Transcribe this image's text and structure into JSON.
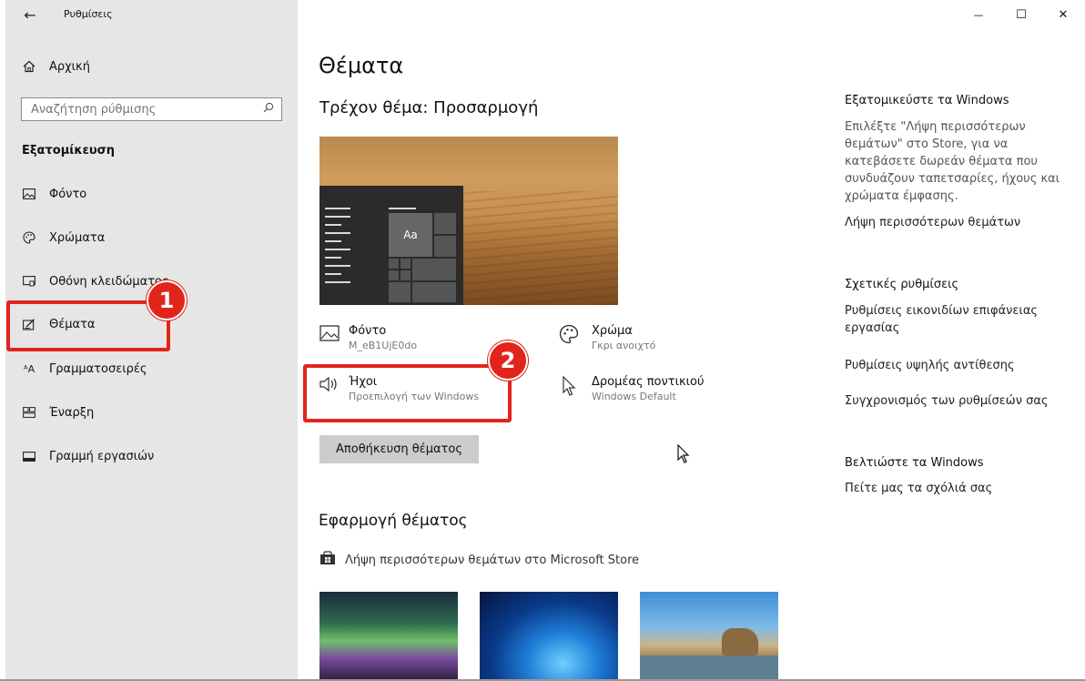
{
  "window": {
    "app_title": "Ρυθμίσεις",
    "back_glyph": "←",
    "minimize_glyph": "—",
    "maximize_glyph": "☐",
    "close_glyph": "✕"
  },
  "sidebar": {
    "home_label": "Αρχική",
    "search_placeholder": "Αναζήτηση ρύθμισης",
    "section_title": "Εξατομίκευση",
    "items": [
      {
        "label": "Φόντο",
        "icon": "picture-icon"
      },
      {
        "label": "Χρώματα",
        "icon": "palette-icon"
      },
      {
        "label": "Οθόνη κλειδώματος",
        "icon": "lock-screen-icon"
      },
      {
        "label": "Θέματα",
        "icon": "themes-icon"
      },
      {
        "label": "Γραμματοσειρές",
        "icon": "fonts-icon"
      },
      {
        "label": "Έναρξη",
        "icon": "start-icon"
      },
      {
        "label": "Γραμμή εργασιών",
        "icon": "taskbar-icon"
      }
    ]
  },
  "main": {
    "page_title": "Θέματα",
    "current_theme": "Τρέχον θέμα: Προσαρμογή",
    "preview_tile_label": "Aa",
    "options": {
      "background": {
        "title": "Φόντο",
        "subtitle": "M_eB1UjE0do"
      },
      "color": {
        "title": "Χρώμα",
        "subtitle": "Γκρι ανοιχτό"
      },
      "sounds": {
        "title": "Ήχοι",
        "subtitle": "Προεπιλογή των Windows"
      },
      "cursor": {
        "title": "Δρομέας ποντικιού",
        "subtitle": "Windows Default"
      }
    },
    "save_button": "Αποθήκευση θέματος",
    "apply_heading": "Εφαρμογή θέματος",
    "store_link": "Λήψη περισσότερων θεμάτων στο Microsoft Store"
  },
  "right_column": {
    "personalize_title": "Εξατομικεύστε τα Windows",
    "personalize_text": "Επιλέξτε \"Λήψη περισσότερων θεμάτων\" στο Store, για να κατεβάσετε δωρεάν θέματα που συνδυάζουν ταπετσαρίες, ήχους και χρώματα έμφασης.",
    "personalize_link": "Λήψη περισσότερων θεμάτων",
    "related_title": "Σχετικές ρυθμίσεις",
    "related_links": [
      "Ρυθμίσεις εικονιδίων επιφάνειας εργασίας",
      "Ρυθμίσεις υψηλής αντίθεσης",
      "Συγχρονισμός των ρυθμίσεών σας"
    ],
    "improve_title": "Βελτιώστε τα Windows",
    "feedback_link": "Πείτε μας τα σχόλιά σας"
  },
  "annotations": {
    "badge1": "1",
    "badge2": "2",
    "color": "#e1251b"
  }
}
